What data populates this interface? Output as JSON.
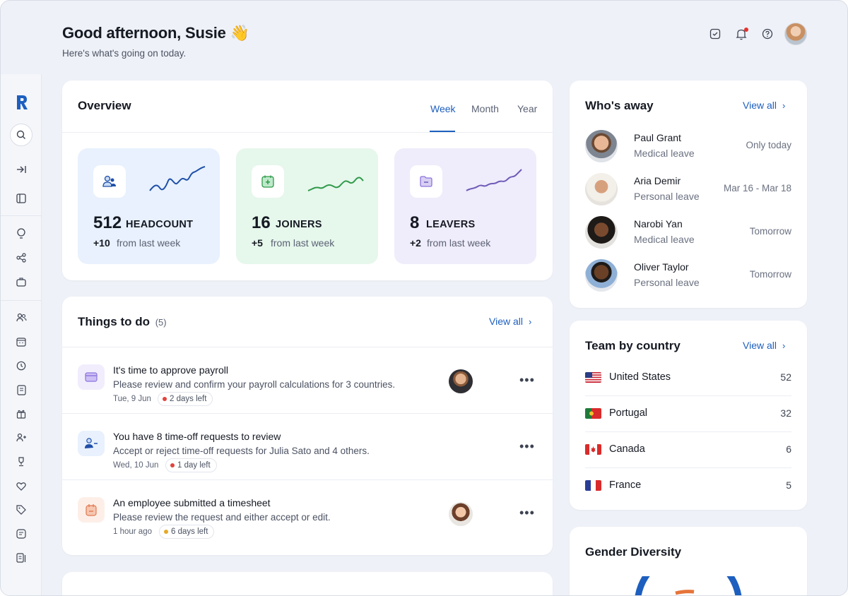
{
  "header": {
    "greeting": "Good afternoon, Susie 👋",
    "subtitle": "Here's what's going on today."
  },
  "overview": {
    "title": "Overview",
    "tabs": [
      "Week",
      "Month",
      "Year"
    ],
    "active_tab": "Week",
    "stats": [
      {
        "value": "512",
        "label": "HEADCOUNT",
        "delta": "+10",
        "delta_text": "from last week",
        "color": "#e8f1fd",
        "accent": "#1f4fa8"
      },
      {
        "value": "16",
        "label": "JOINERS",
        "delta": "+5",
        "delta_text": "from last week",
        "color": "#e6f7ec",
        "accent": "#2f9a4a"
      },
      {
        "value": "8",
        "label": "LEAVERS",
        "delta": "+2",
        "delta_text": "from last week",
        "color": "#efecfb",
        "accent": "#6f5bb8"
      }
    ]
  },
  "todo": {
    "title": "Things to do",
    "count": "(5)",
    "view_all": "View all",
    "items": [
      {
        "title": "It's time to approve payroll",
        "desc": "Please review and confirm your payroll calculations for 3 countries.",
        "date": "Tue, 9 Jun",
        "due": "2 days left",
        "dot": "#e0443e",
        "icon_bg": "#f1edfd",
        "icon_color": "#8d74dd"
      },
      {
        "title": "You have 8 time-off requests to review",
        "desc": "Accept or reject time-off requests for Julia Sato and 4 others.",
        "date": "Wed, 10 Jun",
        "due": "1 day left",
        "dot": "#e0443e",
        "icon_bg": "#e8f1fd",
        "icon_color": "#1f4fa8"
      },
      {
        "title": "An employee submitted a timesheet",
        "desc": "Please review the request and either accept or edit.",
        "date": "1 hour ago",
        "due": "6 days left",
        "dot": "#e5a92a",
        "icon_bg": "#fdefe8",
        "icon_color": "#e07a52"
      }
    ]
  },
  "away": {
    "title": "Who's away",
    "view_all": "View all",
    "people": [
      {
        "name": "Paul Grant",
        "type": "Medical leave",
        "when": "Only today"
      },
      {
        "name": "Aria Demir",
        "type": "Personal leave",
        "when": "Mar 16 - Mar 18"
      },
      {
        "name": "Narobi Yan",
        "type": "Medical leave",
        "when": "Tomorrow"
      },
      {
        "name": "Oliver Taylor",
        "type": "Personal leave",
        "when": "Tomorrow"
      }
    ]
  },
  "countries": {
    "title": "Team by country",
    "view_all": "View all",
    "items": [
      {
        "name": "United States",
        "count": "52"
      },
      {
        "name": "Portugal",
        "count": "32"
      },
      {
        "name": "Canada",
        "count": "6"
      },
      {
        "name": "France",
        "count": "5"
      }
    ]
  },
  "gender": {
    "title": "Gender Diversity"
  },
  "colors": {
    "accent": "#1d5fbf",
    "background": "#eef1f7"
  }
}
